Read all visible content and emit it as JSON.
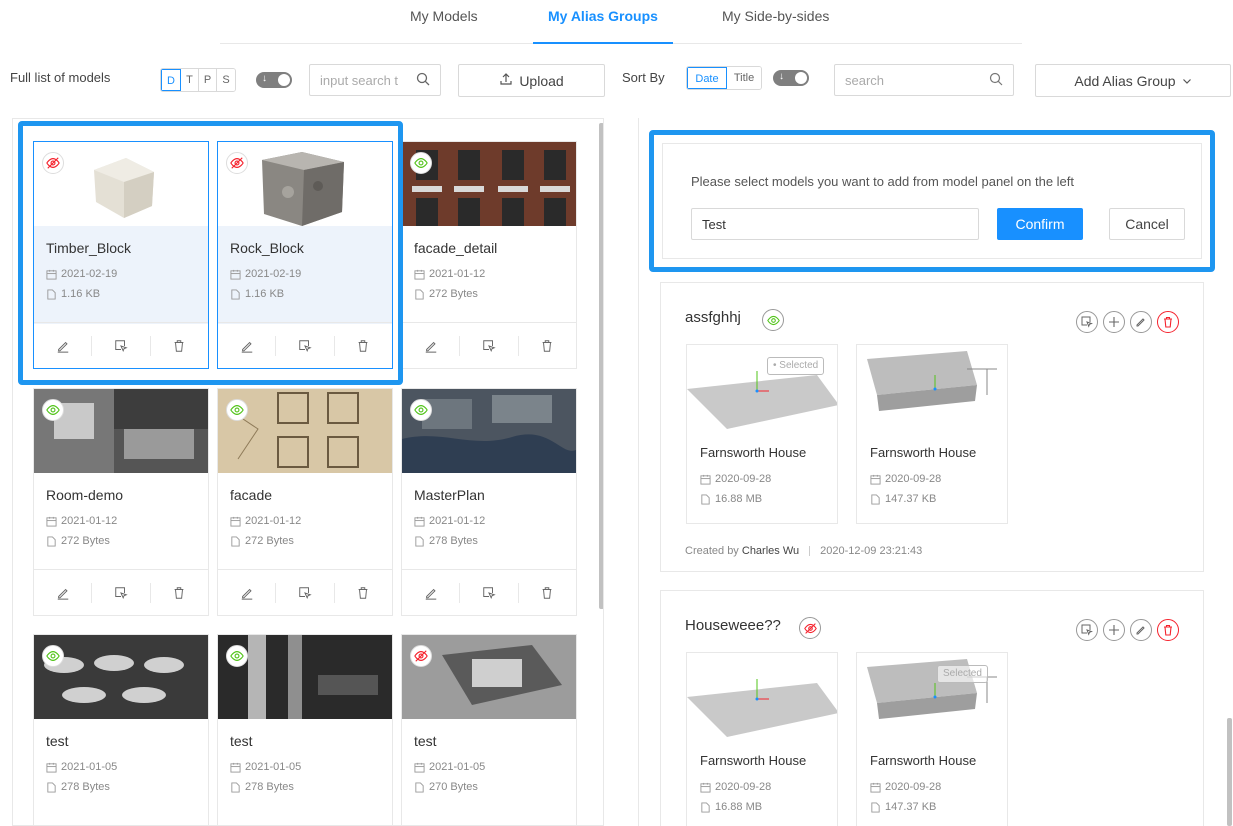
{
  "tabs": [
    {
      "label": "My Models",
      "active": false
    },
    {
      "label": "My Alias Groups",
      "active": true
    },
    {
      "label": "My Side-by-sides",
      "active": false
    }
  ],
  "left_toolbar": {
    "title": "Full list of models",
    "sort_keys": [
      "D",
      "T",
      "P",
      "S"
    ],
    "active_sort": "D",
    "search_placeholder": "input search t",
    "upload_label": "Upload"
  },
  "right_toolbar": {
    "sort_label": "Sort By",
    "sort_keys": [
      "Date",
      "Title"
    ],
    "active_sort": "Date",
    "search_placeholder": "search",
    "add_group_label": "Add Alias Group"
  },
  "models": [
    {
      "name": "Timber_Block",
      "date": "2021-02-19",
      "size": "1.16 KB",
      "visible": false,
      "selected": true
    },
    {
      "name": "Rock_Block",
      "date": "2021-02-19",
      "size": "1.16 KB",
      "visible": false,
      "selected": true
    },
    {
      "name": "facade_detail",
      "date": "2021-01-12",
      "size": "272 Bytes",
      "visible": true,
      "selected": false
    },
    {
      "name": "Room-demo",
      "date": "2021-01-12",
      "size": "272 Bytes",
      "visible": true,
      "selected": false
    },
    {
      "name": "facade",
      "date": "2021-01-12",
      "size": "272 Bytes",
      "visible": true,
      "selected": false
    },
    {
      "name": "MasterPlan",
      "date": "2021-01-12",
      "size": "278 Bytes",
      "visible": true,
      "selected": false
    },
    {
      "name": "test",
      "date": "2021-01-05",
      "size": "278 Bytes",
      "visible": true,
      "selected": false
    },
    {
      "name": "test",
      "date": "2021-01-05",
      "size": "278 Bytes",
      "visible": true,
      "selected": false
    },
    {
      "name": "test",
      "date": "2021-01-05",
      "size": "270 Bytes",
      "visible": false,
      "selected": false
    }
  ],
  "confirm_panel": {
    "instruction": "Please select models you want to add from model panel on the left",
    "name_value": "Test",
    "confirm_label": "Confirm",
    "cancel_label": "Cancel"
  },
  "groups": [
    {
      "title": "assfghhj",
      "visible": true,
      "models": [
        {
          "name": "Farnsworth House",
          "date": "2020-09-28",
          "size": "16.88 MB",
          "badge": "• Selected"
        },
        {
          "name": "Farnsworth House",
          "date": "2020-09-28",
          "size": "147.37 KB",
          "badge": ""
        }
      ],
      "created_by_label": "Created by",
      "created_by": "Charles Wu",
      "created_at": "2020-12-09 23:21:43"
    },
    {
      "title": "Houseweee??",
      "visible": false,
      "models": [
        {
          "name": "Farnsworth House",
          "date": "2020-09-28",
          "size": "16.88 MB",
          "badge": ""
        },
        {
          "name": "Farnsworth House",
          "date": "2020-09-28",
          "size": "147.37 KB",
          "badge": "Selected"
        }
      ]
    }
  ],
  "colors": {
    "accent": "#1890ff",
    "highlight": "#1e96f0",
    "eye_on": "#52c41a",
    "eye_off": "#f5222d"
  }
}
